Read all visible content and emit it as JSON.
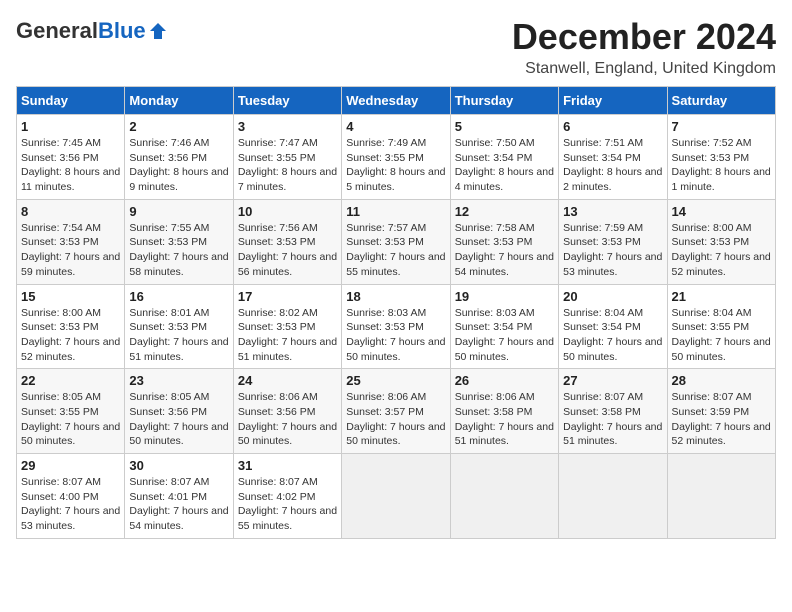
{
  "logo": {
    "general": "General",
    "blue": "Blue"
  },
  "title": "December 2024",
  "subtitle": "Stanwell, England, United Kingdom",
  "columns": [
    "Sunday",
    "Monday",
    "Tuesday",
    "Wednesday",
    "Thursday",
    "Friday",
    "Saturday"
  ],
  "weeks": [
    [
      {
        "day": "1",
        "sunrise": "Sunrise: 7:45 AM",
        "sunset": "Sunset: 3:56 PM",
        "daylight": "Daylight: 8 hours and 11 minutes."
      },
      {
        "day": "2",
        "sunrise": "Sunrise: 7:46 AM",
        "sunset": "Sunset: 3:56 PM",
        "daylight": "Daylight: 8 hours and 9 minutes."
      },
      {
        "day": "3",
        "sunrise": "Sunrise: 7:47 AM",
        "sunset": "Sunset: 3:55 PM",
        "daylight": "Daylight: 8 hours and 7 minutes."
      },
      {
        "day": "4",
        "sunrise": "Sunrise: 7:49 AM",
        "sunset": "Sunset: 3:55 PM",
        "daylight": "Daylight: 8 hours and 5 minutes."
      },
      {
        "day": "5",
        "sunrise": "Sunrise: 7:50 AM",
        "sunset": "Sunset: 3:54 PM",
        "daylight": "Daylight: 8 hours and 4 minutes."
      },
      {
        "day": "6",
        "sunrise": "Sunrise: 7:51 AM",
        "sunset": "Sunset: 3:54 PM",
        "daylight": "Daylight: 8 hours and 2 minutes."
      },
      {
        "day": "7",
        "sunrise": "Sunrise: 7:52 AM",
        "sunset": "Sunset: 3:53 PM",
        "daylight": "Daylight: 8 hours and 1 minute."
      }
    ],
    [
      {
        "day": "8",
        "sunrise": "Sunrise: 7:54 AM",
        "sunset": "Sunset: 3:53 PM",
        "daylight": "Daylight: 7 hours and 59 minutes."
      },
      {
        "day": "9",
        "sunrise": "Sunrise: 7:55 AM",
        "sunset": "Sunset: 3:53 PM",
        "daylight": "Daylight: 7 hours and 58 minutes."
      },
      {
        "day": "10",
        "sunrise": "Sunrise: 7:56 AM",
        "sunset": "Sunset: 3:53 PM",
        "daylight": "Daylight: 7 hours and 56 minutes."
      },
      {
        "day": "11",
        "sunrise": "Sunrise: 7:57 AM",
        "sunset": "Sunset: 3:53 PM",
        "daylight": "Daylight: 7 hours and 55 minutes."
      },
      {
        "day": "12",
        "sunrise": "Sunrise: 7:58 AM",
        "sunset": "Sunset: 3:53 PM",
        "daylight": "Daylight: 7 hours and 54 minutes."
      },
      {
        "day": "13",
        "sunrise": "Sunrise: 7:59 AM",
        "sunset": "Sunset: 3:53 PM",
        "daylight": "Daylight: 7 hours and 53 minutes."
      },
      {
        "day": "14",
        "sunrise": "Sunrise: 8:00 AM",
        "sunset": "Sunset: 3:53 PM",
        "daylight": "Daylight: 7 hours and 52 minutes."
      }
    ],
    [
      {
        "day": "15",
        "sunrise": "Sunrise: 8:00 AM",
        "sunset": "Sunset: 3:53 PM",
        "daylight": "Daylight: 7 hours and 52 minutes."
      },
      {
        "day": "16",
        "sunrise": "Sunrise: 8:01 AM",
        "sunset": "Sunset: 3:53 PM",
        "daylight": "Daylight: 7 hours and 51 minutes."
      },
      {
        "day": "17",
        "sunrise": "Sunrise: 8:02 AM",
        "sunset": "Sunset: 3:53 PM",
        "daylight": "Daylight: 7 hours and 51 minutes."
      },
      {
        "day": "18",
        "sunrise": "Sunrise: 8:03 AM",
        "sunset": "Sunset: 3:53 PM",
        "daylight": "Daylight: 7 hours and 50 minutes."
      },
      {
        "day": "19",
        "sunrise": "Sunrise: 8:03 AM",
        "sunset": "Sunset: 3:54 PM",
        "daylight": "Daylight: 7 hours and 50 minutes."
      },
      {
        "day": "20",
        "sunrise": "Sunrise: 8:04 AM",
        "sunset": "Sunset: 3:54 PM",
        "daylight": "Daylight: 7 hours and 50 minutes."
      },
      {
        "day": "21",
        "sunrise": "Sunrise: 8:04 AM",
        "sunset": "Sunset: 3:55 PM",
        "daylight": "Daylight: 7 hours and 50 minutes."
      }
    ],
    [
      {
        "day": "22",
        "sunrise": "Sunrise: 8:05 AM",
        "sunset": "Sunset: 3:55 PM",
        "daylight": "Daylight: 7 hours and 50 minutes."
      },
      {
        "day": "23",
        "sunrise": "Sunrise: 8:05 AM",
        "sunset": "Sunset: 3:56 PM",
        "daylight": "Daylight: 7 hours and 50 minutes."
      },
      {
        "day": "24",
        "sunrise": "Sunrise: 8:06 AM",
        "sunset": "Sunset: 3:56 PM",
        "daylight": "Daylight: 7 hours and 50 minutes."
      },
      {
        "day": "25",
        "sunrise": "Sunrise: 8:06 AM",
        "sunset": "Sunset: 3:57 PM",
        "daylight": "Daylight: 7 hours and 50 minutes."
      },
      {
        "day": "26",
        "sunrise": "Sunrise: 8:06 AM",
        "sunset": "Sunset: 3:58 PM",
        "daylight": "Daylight: 7 hours and 51 minutes."
      },
      {
        "day": "27",
        "sunrise": "Sunrise: 8:07 AM",
        "sunset": "Sunset: 3:58 PM",
        "daylight": "Daylight: 7 hours and 51 minutes."
      },
      {
        "day": "28",
        "sunrise": "Sunrise: 8:07 AM",
        "sunset": "Sunset: 3:59 PM",
        "daylight": "Daylight: 7 hours and 52 minutes."
      }
    ],
    [
      {
        "day": "29",
        "sunrise": "Sunrise: 8:07 AM",
        "sunset": "Sunset: 4:00 PM",
        "daylight": "Daylight: 7 hours and 53 minutes."
      },
      {
        "day": "30",
        "sunrise": "Sunrise: 8:07 AM",
        "sunset": "Sunset: 4:01 PM",
        "daylight": "Daylight: 7 hours and 54 minutes."
      },
      {
        "day": "31",
        "sunrise": "Sunrise: 8:07 AM",
        "sunset": "Sunset: 4:02 PM",
        "daylight": "Daylight: 7 hours and 55 minutes."
      },
      null,
      null,
      null,
      null
    ]
  ]
}
